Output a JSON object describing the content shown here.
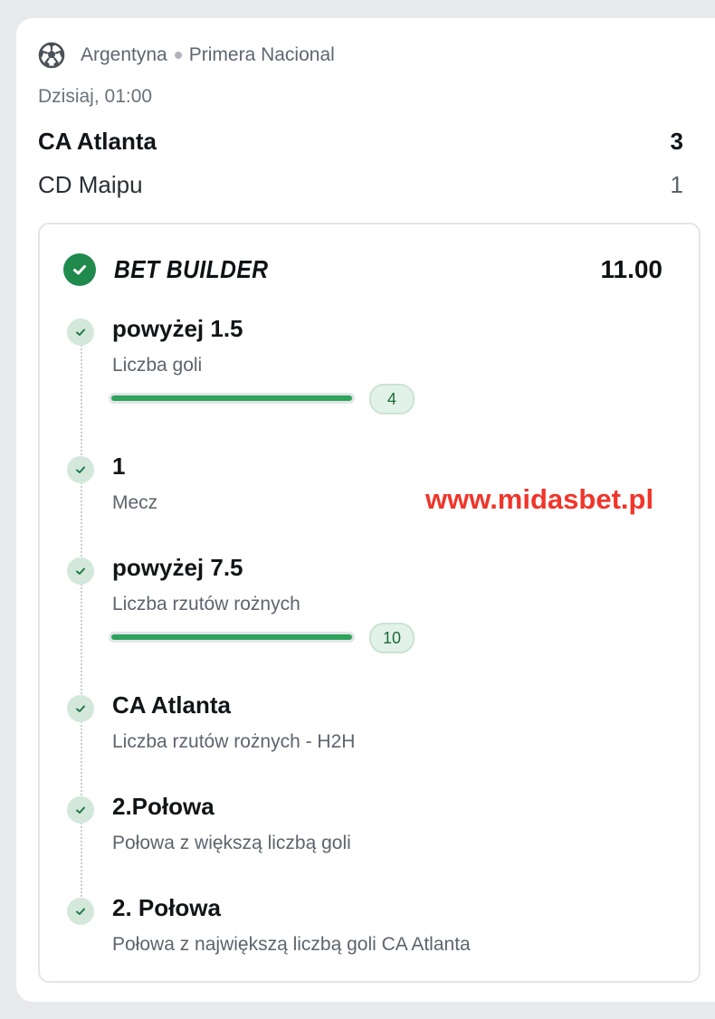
{
  "match": {
    "sport_icon": "soccer-ball-icon",
    "country": "Argentyna",
    "league": "Primera Nacional",
    "time": "Dzisiaj, 01:00",
    "home_team": "CA Atlanta",
    "home_score": "3",
    "away_team": "CD Maipu",
    "away_score": "1"
  },
  "bet_builder": {
    "status_icon": "check-circle-icon",
    "title": "BET BUILDER",
    "odds": "11.00",
    "legs": [
      {
        "title": "powyżej 1.5",
        "market": "Liczba goli",
        "progress_value": "4",
        "progress_fraction": 1.0
      },
      {
        "title": "1",
        "market": "Mecz"
      },
      {
        "title": "powyżej 7.5",
        "market": "Liczba rzutów rożnych",
        "progress_value": "10",
        "progress_fraction": 1.0
      },
      {
        "title": "CA Atlanta",
        "market": "Liczba rzutów rożnych - H2H"
      },
      {
        "title": "2.Połowa",
        "market": "Połowa z większą liczbą goli"
      },
      {
        "title": "2. Połowa",
        "market": "Połowa z największą liczbą goli CA Atlanta"
      }
    ]
  },
  "watermark": "www.midasbet.pl",
  "colors": {
    "accent_green": "#1f8a4c",
    "progress_green": "#2ea35c",
    "watermark_red": "#f0352b"
  }
}
